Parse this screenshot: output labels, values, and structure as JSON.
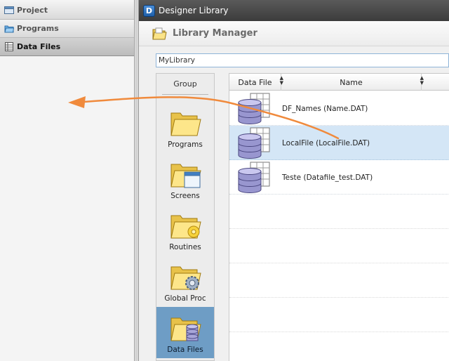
{
  "nav": {
    "items": [
      {
        "label": "Project"
      },
      {
        "label": "Programs"
      },
      {
        "label": "Data Files"
      }
    ]
  },
  "window": {
    "icon_letter": "D",
    "title": "Designer Library"
  },
  "header": {
    "title": "Library Manager"
  },
  "library": {
    "value": "MyLibrary"
  },
  "groups": {
    "header": "Group",
    "items": [
      {
        "label": "Programs"
      },
      {
        "label": "Screens"
      },
      {
        "label": "Routines"
      },
      {
        "label": "Global Proc"
      },
      {
        "label": "Data Files"
      }
    ]
  },
  "grid": {
    "columns": [
      "Data File",
      "Name"
    ],
    "rows": [
      {
        "name": "DF_Names (Name.DAT)"
      },
      {
        "name": "LocalFile (LocalFile.DAT)"
      },
      {
        "name": "Teste (Datafile_test.DAT)"
      }
    ]
  },
  "colors": {
    "annotation_arrow": "#f08a3c",
    "selection": "#d4e6f6",
    "group_selected": "#6e9dc5"
  }
}
